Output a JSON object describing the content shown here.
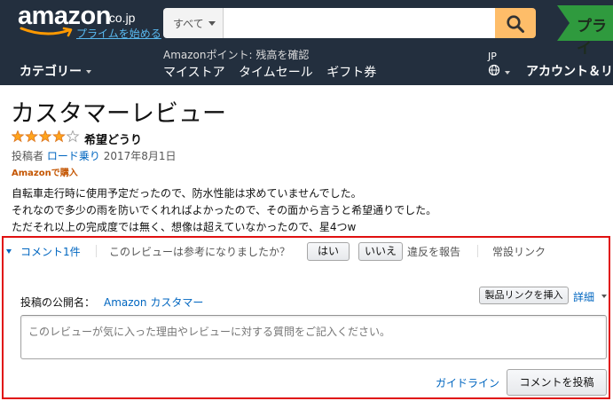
{
  "header": {
    "logo_text": "amazon",
    "logo_suffix": ".co.jp",
    "prime_link": "プライムを始める",
    "search": {
      "category": "すべて",
      "value": "",
      "placeholder": ""
    },
    "prime_banner": "プライ",
    "points_text": "Amazonポイント: 残高を確認",
    "category_menu": "カテゴリー",
    "nav_links": [
      "マイストア",
      "タイムセール",
      "ギフト券"
    ],
    "language": "JP",
    "account": "アカウント＆リ"
  },
  "review": {
    "page_title": "カスタマーレビュー",
    "rating": 4,
    "rating_max": 5,
    "headline": "希望どうり",
    "author_prefix": "投稿者",
    "author": "ロード乗り",
    "date": "2017年8月1日",
    "verified": "Amazonで購入",
    "body": [
      "自転車走行時に使用予定だったので、防水性能は求めていませんでした。",
      "それなので多少の雨を防いでくれればよかったので、その面から言うと希望通りでした。",
      "ただそれ以上の完成度では無く、想像は超えていなかったので、星4つw"
    ]
  },
  "actions": {
    "comments_link": "コメント1件",
    "helpful_question": "このレビューは参考になりましたか？",
    "yes_button": "はい",
    "no_button": "いいえ",
    "report": "違反を報告",
    "permalink": "常設リンク"
  },
  "comment_form": {
    "public_name_label": "投稿の公開名：",
    "public_name": "Amazon カスタマー",
    "insert_product_link": "製品リンクを挿入",
    "details": "詳細",
    "placeholder": "このレビューが気に入った理由やレビューに対する質問をご記入ください。",
    "value": "",
    "guideline": "ガイドライン",
    "submit": "コメントを投稿"
  },
  "colors": {
    "nav_bg": "#232f3e",
    "search_button": "#febd69",
    "link": "#0066c0",
    "star": "#ffa41c",
    "verified": "#c45500",
    "highlight_border": "#e01010"
  },
  "icons": [
    "amazon-smile-logo",
    "search-icon",
    "globe-icon",
    "star-icon",
    "caret-down-icon"
  ]
}
